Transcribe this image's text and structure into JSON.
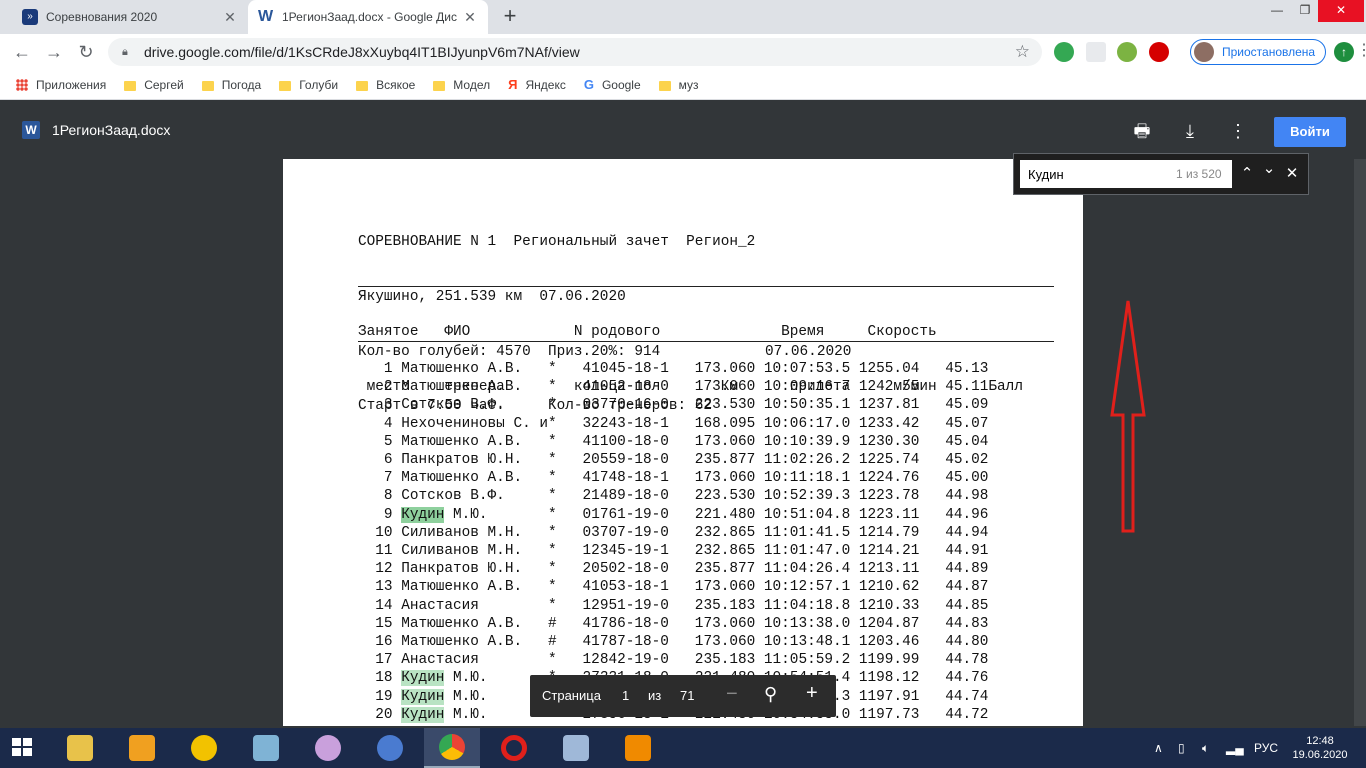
{
  "browser": {
    "tabs": [
      {
        "title": "Соревнования 2020",
        "favicon": "calendar-favicon"
      },
      {
        "title": "1РегионЗаад.docx - Google Дис",
        "favicon": "word-favicon"
      }
    ],
    "url": "drive.google.com/file/d/1KsCRdeJ8xXuybq4IT1BIJyunpV6m7NAf/view",
    "profile_label": "Приостановлена",
    "bookmarks": [
      "Приложения",
      "Сергей",
      "Погода",
      "Голуби",
      "Всякое",
      "Модел",
      "Яндекс",
      "Google",
      "муз"
    ]
  },
  "viewer": {
    "doc_title": "1РегионЗаад.docx",
    "signin_label": "Войти",
    "find": {
      "query": "Кудин",
      "count": "1 из 520"
    },
    "pager": {
      "label": "Страница",
      "current": "1",
      "of": "из",
      "total": "71"
    }
  },
  "document": {
    "header_lines": [
      "СОРЕВНОВАНИЕ N 1  Региональный зачет  Регион_2",
      "Якушино, 251.539 км  07.06.2020",
      "Кол-во голубей: 4570  Приз.20%: 914",
      "Старт в 7.50 час.     Кол-во тренеров: 62"
    ],
    "column_header_1": "Занятое   ФИО            N родового              Время     Скорость",
    "column_header_2": " место    тренера        кольца-пол       Км      прилета     м/мин      Балл",
    "date": "07.06.2020",
    "rows": [
      {
        "place": "1",
        "name": "Матюшенко А.В.",
        "mark": "*",
        "ring": "41045-18-1",
        "km": "173.060",
        "time": "10:07:53.5",
        "speed": "1255.04",
        "score": "45.13"
      },
      {
        "place": "2",
        "name": "Матюшенко А.В.",
        "mark": "*",
        "ring": "41052-18-0",
        "km": "173.060",
        "time": "10:09:16.7",
        "speed": "1242.55",
        "score": "45.11"
      },
      {
        "place": "3",
        "name": "Сотсков В.Ф.",
        "mark": "*",
        "ring": "03770-16-0",
        "km": "223.530",
        "time": "10:50:35.1",
        "speed": "1237.81",
        "score": "45.09"
      },
      {
        "place": "4",
        "name": "Нехочениновы С. и",
        "mark": "*",
        "ring": "32243-18-1",
        "km": "168.095",
        "time": "10:06:17.0",
        "speed": "1233.42",
        "score": "45.07"
      },
      {
        "place": "5",
        "name": "Матюшенко А.В.",
        "mark": "*",
        "ring": "41100-18-0",
        "km": "173.060",
        "time": "10:10:39.9",
        "speed": "1230.30",
        "score": "45.04"
      },
      {
        "place": "6",
        "name": "Панкратов Ю.Н.",
        "mark": "*",
        "ring": "20559-18-0",
        "km": "235.877",
        "time": "11:02:26.2",
        "speed": "1225.74",
        "score": "45.02"
      },
      {
        "place": "7",
        "name": "Матюшенко А.В.",
        "mark": "*",
        "ring": "41748-18-1",
        "km": "173.060",
        "time": "10:11:18.1",
        "speed": "1224.76",
        "score": "45.00"
      },
      {
        "place": "8",
        "name": "Сотсков В.Ф.",
        "mark": "*",
        "ring": "21489-18-0",
        "km": "223.530",
        "time": "10:52:39.3",
        "speed": "1223.78",
        "score": "44.98"
      },
      {
        "place": "9",
        "name": "Кудин М.Ю.",
        "mark": "*",
        "ring": "01761-19-0",
        "km": "221.480",
        "time": "10:51:04.8",
        "speed": "1223.11",
        "score": "44.96"
      },
      {
        "place": "10",
        "name": "Силиванов М.Н.",
        "mark": "*",
        "ring": "03707-19-0",
        "km": "232.865",
        "time": "11:01:41.5",
        "speed": "1214.79",
        "score": "44.94"
      },
      {
        "place": "11",
        "name": "Силиванов М.Н.",
        "mark": "*",
        "ring": "12345-19-1",
        "km": "232.865",
        "time": "11:01:47.0",
        "speed": "1214.21",
        "score": "44.91"
      },
      {
        "place": "12",
        "name": "Панкратов Ю.Н.",
        "mark": "*",
        "ring": "20502-18-0",
        "km": "235.877",
        "time": "11:04:26.4",
        "speed": "1213.11",
        "score": "44.89"
      },
      {
        "place": "13",
        "name": "Матюшенко А.В.",
        "mark": "*",
        "ring": "41053-18-1",
        "km": "173.060",
        "time": "10:12:57.1",
        "speed": "1210.62",
        "score": "44.87"
      },
      {
        "place": "14",
        "name": "Анастасия",
        "mark": "*",
        "ring": "12951-19-0",
        "km": "235.183",
        "time": "11:04:18.8",
        "speed": "1210.33",
        "score": "44.85"
      },
      {
        "place": "15",
        "name": "Матюшенко А.В.",
        "mark": "#",
        "ring": "41786-18-0",
        "km": "173.060",
        "time": "10:13:38.0",
        "speed": "1204.87",
        "score": "44.83"
      },
      {
        "place": "16",
        "name": "Матюшенко А.В.",
        "mark": "#",
        "ring": "41787-18-0",
        "km": "173.060",
        "time": "10:13:48.1",
        "speed": "1203.46",
        "score": "44.80"
      },
      {
        "place": "17",
        "name": "Анастасия",
        "mark": "*",
        "ring": "12842-19-0",
        "km": "235.183",
        "time": "11:05:59.2",
        "speed": "1199.99",
        "score": "44.78"
      },
      {
        "place": "18",
        "name": "Кудин М.Ю.",
        "mark": "*",
        "ring": "27331-18-0",
        "km": "221.480",
        "time": "10:54:51.4",
        "speed": "1198.12",
        "score": "44.76"
      },
      {
        "place": "19",
        "name": "Кудин М.Ю.",
        "mark": "*",
        "ring": "27270-18-0",
        "km": "221.480",
        "time": "10:54:53.3",
        "speed": "1197.91",
        "score": "44.74"
      },
      {
        "place": "20",
        "name": "Кудин М.Ю.",
        "mark": "*",
        "ring": "27356-18-1",
        "km": "221.480",
        "time": "10:54:55.0",
        "speed": "1197.73",
        "score": "44.72"
      }
    ]
  },
  "taskbar": {
    "language": "РУС",
    "time": "12:48",
    "date": "19.06.2020"
  },
  "colors": {
    "find_highlight": "#b9e3c3",
    "annotation_arrow": "#e0201b",
    "signin_blue": "#4285f4"
  }
}
